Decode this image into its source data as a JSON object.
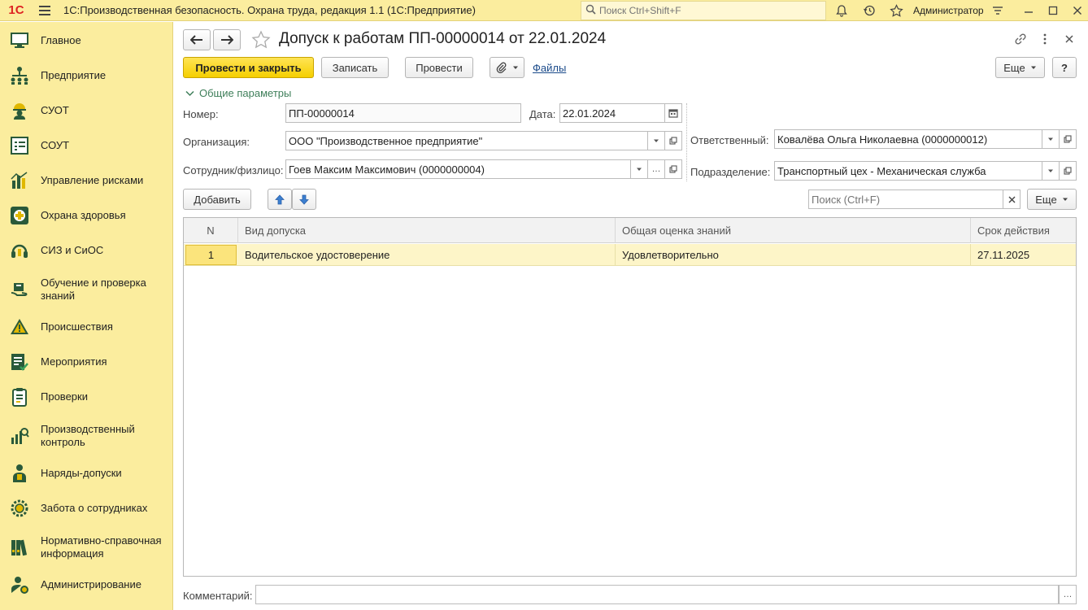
{
  "titlebar": {
    "logo": "1С",
    "title": "1С:Производственная безопасность. Охрана труда, редакция 1.1  (1С:Предприятие)",
    "search_placeholder": "Поиск Ctrl+Shift+F",
    "user": "Администратор"
  },
  "sidebar": {
    "items": [
      {
        "label": "Главное",
        "icon": "monitor-icon"
      },
      {
        "label": "Предприятие",
        "icon": "org-structure-icon"
      },
      {
        "label": "СУОТ",
        "icon": "worker-helmet-icon"
      },
      {
        "label": "СОУТ",
        "icon": "checklist-icon"
      },
      {
        "label": "Управление рисками",
        "icon": "risk-chart-icon"
      },
      {
        "label": "Охрана здоровья",
        "icon": "medical-cross-icon"
      },
      {
        "label": "СИЗ и СиОС",
        "icon": "protective-gear-icon"
      },
      {
        "label": "Обучение и проверка знаний",
        "icon": "education-icon"
      },
      {
        "label": "Происшествия",
        "icon": "warning-icon"
      },
      {
        "label": "Мероприятия",
        "icon": "task-list-icon"
      },
      {
        "label": "Проверки",
        "icon": "clipboard-icon"
      },
      {
        "label": "Производственный контроль",
        "icon": "control-chart-icon"
      },
      {
        "label": "Наряды-допуски",
        "icon": "permit-icon"
      },
      {
        "label": "Забота о сотрудниках",
        "icon": "care-gear-icon"
      },
      {
        "label": "Нормативно-справочная информация",
        "icon": "binders-icon"
      },
      {
        "label": "Администрирование",
        "icon": "admin-icon"
      }
    ]
  },
  "document": {
    "title": "Допуск к работам ПП-00000014 от 22.01.2024",
    "toolbar": {
      "post_close": "Провести и закрыть",
      "save": "Записать",
      "post": "Провести",
      "files": "Файлы",
      "more": "Еще",
      "help": "?"
    },
    "section": "Общие параметры",
    "fields": {
      "number_label": "Номер:",
      "number": "ПП-00000014",
      "date_label": "Дата:",
      "date": "22.01.2024",
      "org_label": "Организация:",
      "org": "ООО \"Производственное предприятие\"",
      "employee_label": "Сотрудник/физлицо:",
      "employee": "Гоев Максим Максимович (0000000004)",
      "responsible_label": "Ответственный:",
      "responsible": "Ковалёва Ольга Николаевна (0000000012)",
      "department_label": "Подразделение:",
      "department": "Транспортный цех - Механическая служба"
    },
    "table_toolbar": {
      "add": "Добавить",
      "search_placeholder": "Поиск (Ctrl+F)",
      "more": "Еще"
    },
    "table": {
      "columns": [
        "N",
        "Вид допуска",
        "Общая оценка знаний",
        "Срок действия"
      ],
      "rows": [
        [
          "1",
          "Водительское удостоверение",
          "Удовлетворительно",
          "27.11.2025"
        ]
      ]
    },
    "comment_label": "Комментарий:",
    "comment": ""
  },
  "colors": {
    "panel": "#fbed9e",
    "primary_button": "#f5cf00",
    "selected_row": "#fdf5c8",
    "link": "#1a4a8a",
    "section": "#3f7f5a"
  }
}
